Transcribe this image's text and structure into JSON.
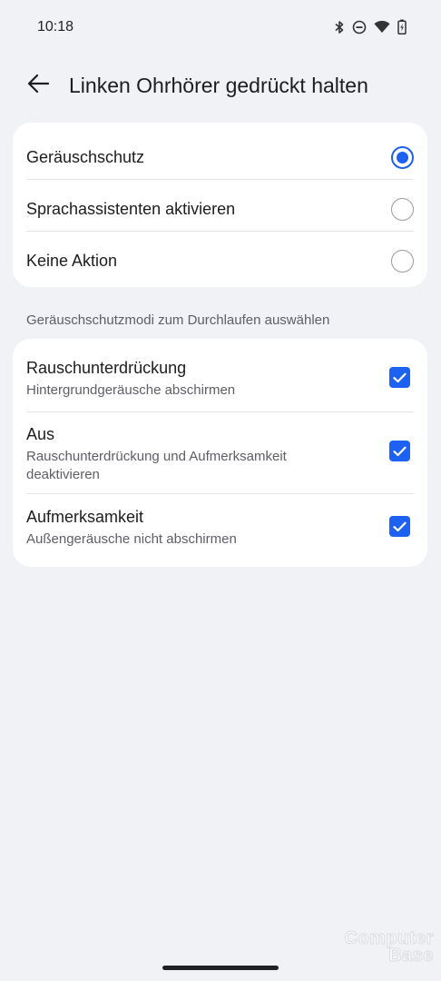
{
  "status_bar": {
    "time": "10:18",
    "icons": [
      "bluetooth-icon",
      "do-not-disturb-icon",
      "wifi-icon",
      "battery-charging-icon"
    ]
  },
  "header": {
    "back_icon": "arrow-left-icon",
    "title": "Linken Ohrhörer gedrückt halten"
  },
  "options": [
    {
      "label": "Geräuschschutz",
      "selected": true
    },
    {
      "label": "Sprachassistenten aktivieren",
      "selected": false
    },
    {
      "label": "Keine Aktion",
      "selected": false
    }
  ],
  "modes_section": {
    "label": "Geräuschschutzmodi zum Durchlaufen auswählen",
    "items": [
      {
        "title": "Rauschunterdrückung",
        "subtitle": "Hintergrundgeräusche abschirmen",
        "checked": true
      },
      {
        "title": "Aus",
        "subtitle": "Rauschunterdrückung und Aufmerksamkeit deaktivieren",
        "checked": true
      },
      {
        "title": "Aufmerksamkeit",
        "subtitle": "Außengeräusche nicht abschirmen",
        "checked": true
      }
    ]
  },
  "watermark": {
    "line1": "Computer",
    "line2": "Base"
  },
  "colors": {
    "accent": "#1c61f2",
    "background": "#f1f2f5",
    "card": "#ffffff",
    "primary_text": "#1d1d20",
    "secondary_text": "#5d5e66"
  }
}
